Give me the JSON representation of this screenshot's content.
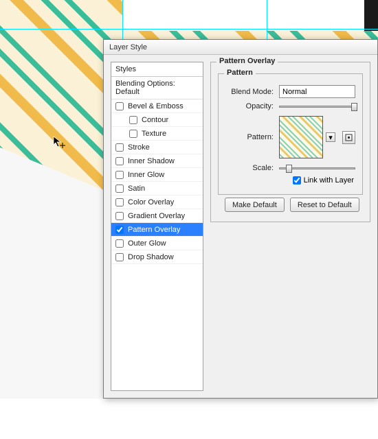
{
  "dialog": {
    "title": "Layer Style",
    "styles_header": "Styles",
    "blending_label": "Blending Options: Default",
    "items": [
      {
        "label": "Bevel & Emboss",
        "checked": false,
        "indent": false,
        "selected": false
      },
      {
        "label": "Contour",
        "checked": false,
        "indent": true,
        "selected": false
      },
      {
        "label": "Texture",
        "checked": false,
        "indent": true,
        "selected": false
      },
      {
        "label": "Stroke",
        "checked": false,
        "indent": false,
        "selected": false
      },
      {
        "label": "Inner Shadow",
        "checked": false,
        "indent": false,
        "selected": false
      },
      {
        "label": "Inner Glow",
        "checked": false,
        "indent": false,
        "selected": false
      },
      {
        "label": "Satin",
        "checked": false,
        "indent": false,
        "selected": false
      },
      {
        "label": "Color Overlay",
        "checked": false,
        "indent": false,
        "selected": false
      },
      {
        "label": "Gradient Overlay",
        "checked": false,
        "indent": false,
        "selected": false
      },
      {
        "label": "Pattern Overlay",
        "checked": true,
        "indent": false,
        "selected": true
      },
      {
        "label": "Outer Glow",
        "checked": false,
        "indent": false,
        "selected": false
      },
      {
        "label": "Drop Shadow",
        "checked": false,
        "indent": false,
        "selected": false
      }
    ]
  },
  "pattern_overlay": {
    "group_title": "Pattern Overlay",
    "inner_title": "Pattern",
    "blend_mode_label": "Blend Mode:",
    "blend_mode_value": "Normal",
    "opacity_label": "Opacity:",
    "pattern_label": "Pattern:",
    "scale_label": "Scale:",
    "link_label": "Link with Layer",
    "link_checked": true,
    "make_default": "Make Default",
    "reset_default": "Reset to Default"
  }
}
